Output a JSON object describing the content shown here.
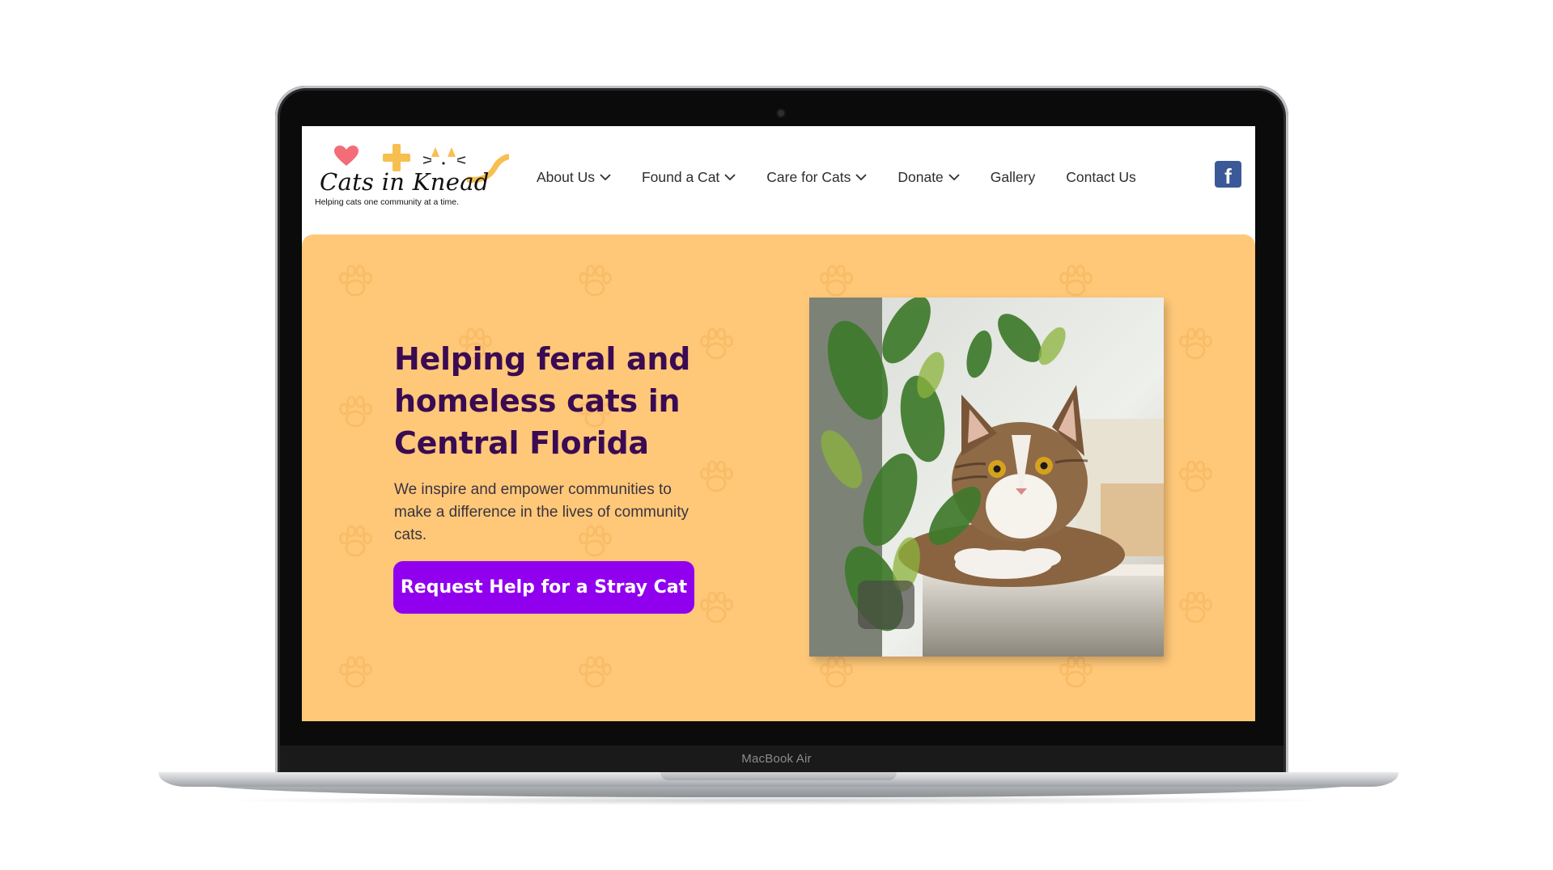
{
  "brand": {
    "name": "Cats in Knead",
    "tagline": "Helping cats one community at a time."
  },
  "nav": {
    "items": [
      {
        "label": "About Us",
        "dropdown": true
      },
      {
        "label": "Found a Cat",
        "dropdown": true
      },
      {
        "label": "Care for Cats",
        "dropdown": true
      },
      {
        "label": "Donate",
        "dropdown": true
      },
      {
        "label": "Gallery",
        "dropdown": false
      },
      {
        "label": "Contact Us",
        "dropdown": false
      }
    ],
    "social": {
      "facebook_glyph": "f",
      "icon": "facebook-icon"
    }
  },
  "hero": {
    "title": "Helping feral and homeless cats in Central Florida",
    "text": "We inspire and empower communities to make a difference in the lives of community cats.",
    "cta_label": "Request Help for a Stray Cat",
    "photo_icon": "tabby-cat-photo"
  },
  "device": {
    "model_label": "MacBook Air"
  },
  "colors": {
    "hero_bg": "#ffc879",
    "title": "#3a0b52",
    "cta": "#9000ee",
    "facebook": "#3b5998"
  }
}
